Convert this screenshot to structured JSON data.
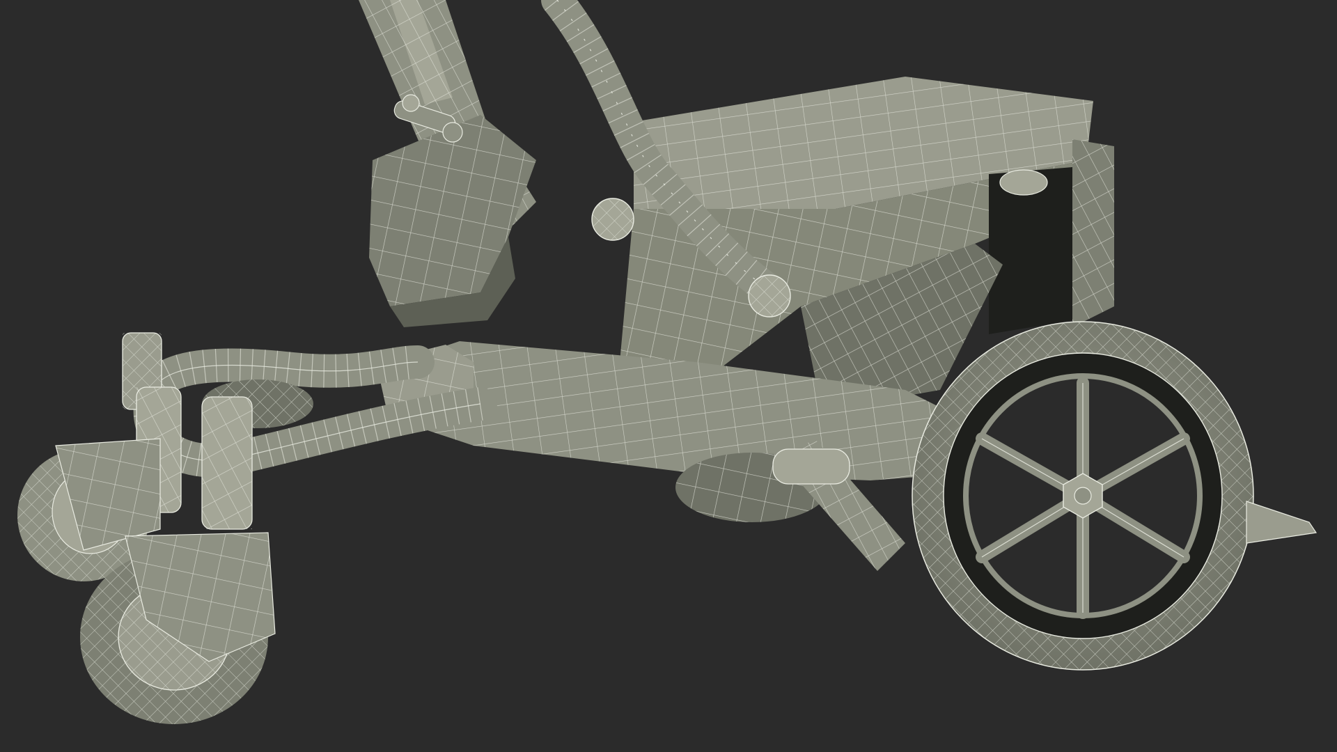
{
  "scene": {
    "subject": "wireframe-3d-render",
    "colors": {
      "background": "#2b2b2b",
      "surface": "#8e9183",
      "surface_light": "#a4a697",
      "surface_dark": "#6f7266",
      "shadow": "#4a4c44",
      "cavity": "#1e1f1c",
      "wire": "#e9ebe1"
    }
  }
}
